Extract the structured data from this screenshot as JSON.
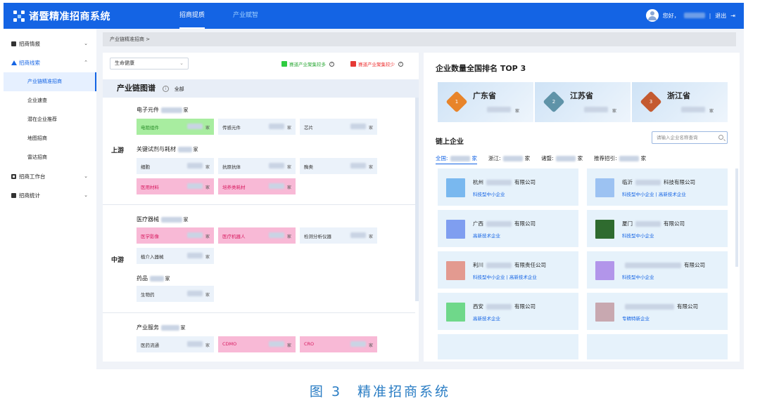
{
  "app": {
    "title": "诸暨精准招商系统"
  },
  "nav": {
    "tabs": [
      {
        "label": "招商提质"
      },
      {
        "label": "产业赋智"
      }
    ]
  },
  "user": {
    "greeting": "您好，",
    "logout": "退出"
  },
  "sidebar": {
    "items": [
      {
        "label": "招商情报"
      },
      {
        "label": "招商线索",
        "subs": [
          "产业链精准招商",
          "企业速查",
          "潜在企业推荐",
          "地图招商",
          "雷达招商"
        ]
      },
      {
        "label": "招商工作台"
      },
      {
        "label": "招商统计"
      }
    ]
  },
  "breadcrumb": "产业链精准招商 >",
  "left": {
    "select": "生命健康",
    "legend_more": "赛道产业聚集较多",
    "legend_less": "赛道产业聚集较少",
    "chain_title": "产业链图谱",
    "chain_all": "全部",
    "unit": "家",
    "stages": [
      "上游",
      "中游"
    ],
    "groups": [
      "电子元件",
      "关键试剂与耗材",
      "医疗器械",
      "药品",
      "产业服务"
    ],
    "cells": [
      "电阻组件",
      "传感元件",
      "芯片",
      "细胞",
      "抗原抗体",
      "酶类",
      "医用材料",
      "培养类耗材",
      "医学影像",
      "医疗机器人",
      "检测分析仪器",
      "植介入器械",
      "生物药",
      "医药流通",
      "CDMO",
      "CRO"
    ]
  },
  "right": {
    "title": "企业数量全国排名 TOP 3",
    "provinces": [
      "广东省",
      "江苏省",
      "浙江省"
    ],
    "ranks": [
      "1",
      "2",
      "3"
    ],
    "unit": "家",
    "chain_title": "链上企业",
    "search_placeholder": "请输入企业名称查询",
    "filters": [
      "全国:",
      "浙江:",
      "诸暨:",
      "推荐招引:"
    ],
    "companies": [
      {
        "name_a": "杭州",
        "name_b": "有限公司",
        "tags": "科技型中小企业"
      },
      {
        "name_a": "临沂",
        "name_b": "科技有限公司",
        "tags": "科技型中小企业 | 高新技术企业"
      },
      {
        "name_a": "广西",
        "name_b": "有限公司",
        "tags": "高新技术企业"
      },
      {
        "name_a": "厦门",
        "name_b": "有限公司",
        "tags": "科技型中小企业"
      },
      {
        "name_a": "利川",
        "name_b": "有限责任公司",
        "tags": "科技型中小企业 | 高新技术企业"
      },
      {
        "name_a": "",
        "name_b": "有限公司",
        "tags": "科技型中小企业"
      },
      {
        "name_a": "西安",
        "name_b": "有限公司",
        "tags": "高新技术企业"
      },
      {
        "name_a": "",
        "name_b": "有限公司",
        "tags": "专精特新企业"
      }
    ]
  },
  "caption": "图 3　精准招商系统",
  "colors": {
    "brand": "#1464e4",
    "green": "#a8eda0",
    "pink": "#f8b9d6",
    "caption": "#2a7dc4"
  }
}
